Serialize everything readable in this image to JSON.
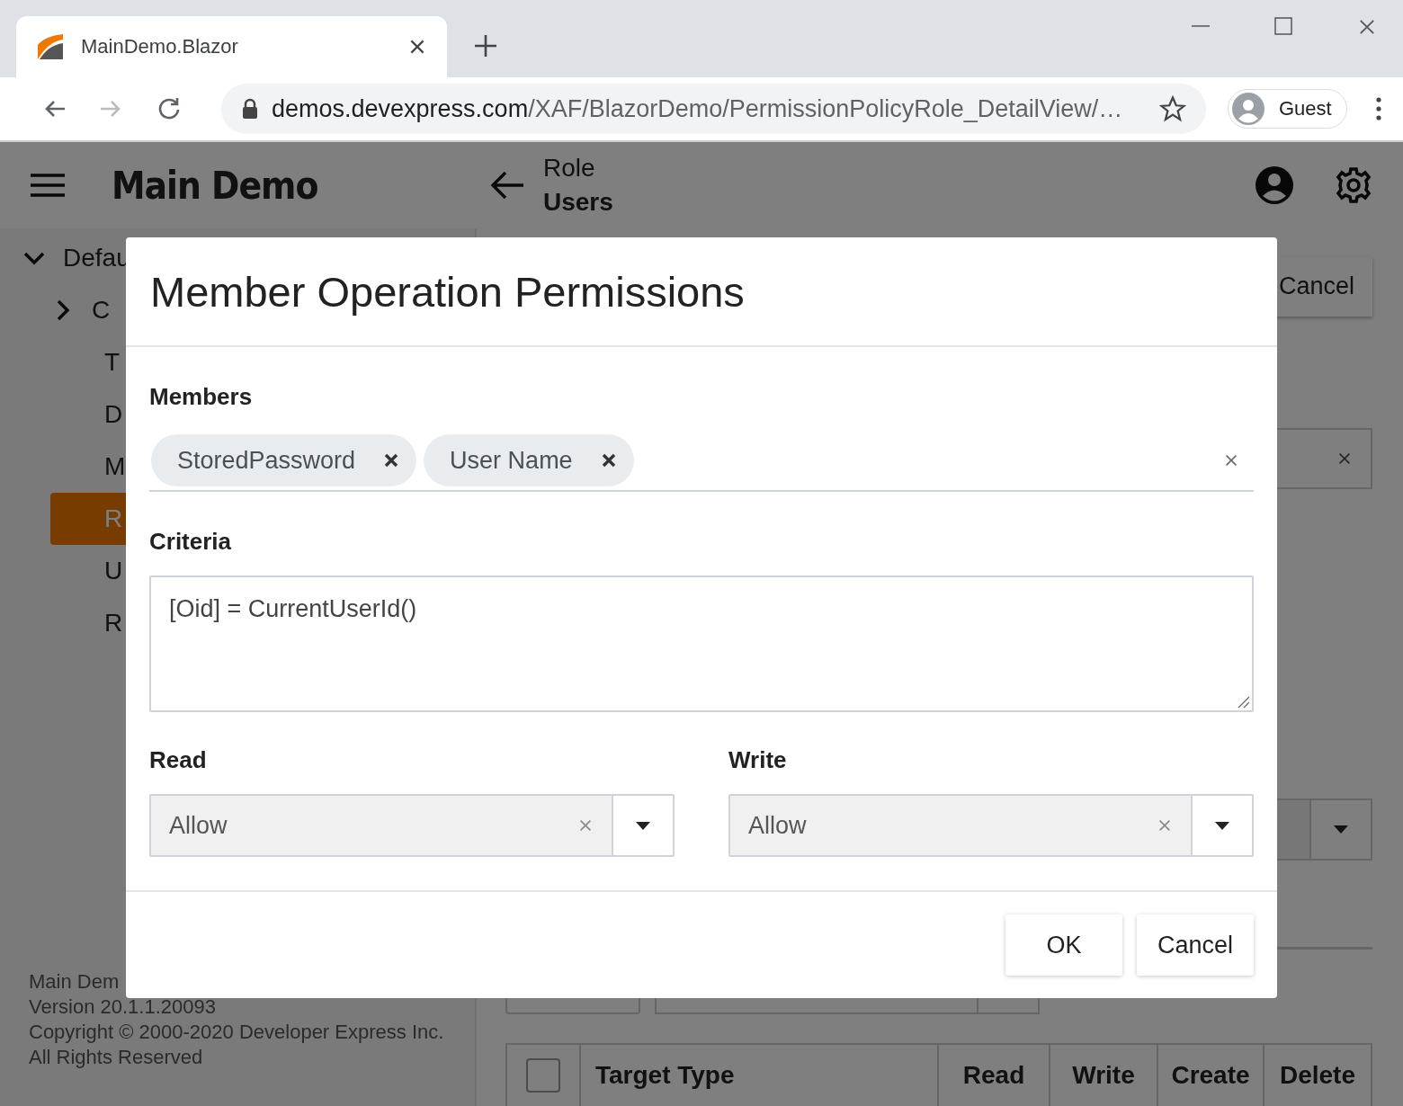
{
  "browser": {
    "tab_title": "MainDemo.Blazor",
    "nav": [
      {
        "kind": "back",
        "disabled": false
      },
      {
        "kind": "forward",
        "disabled": true
      },
      {
        "kind": "reload",
        "disabled": false
      }
    ],
    "url_host": "demos.devexpress.com",
    "url_path": "/XAF/BlazorDemo/PermissionPolicyRole_DetailView/…",
    "profile_name": "Guest"
  },
  "app": {
    "title": "Main Demo",
    "breadcrumb_parent": "Role",
    "breadcrumb_current": "Users"
  },
  "sidebar": {
    "items": [
      {
        "label": "Defau",
        "expanded": true,
        "selected": false,
        "children": [
          {
            "label": "C",
            "expanded": false,
            "selected": false
          },
          {
            "label": "T",
            "selected": false
          },
          {
            "label": "D",
            "selected": false
          },
          {
            "label": "M",
            "selected": false
          },
          {
            "label": "R",
            "selected": true
          },
          {
            "label": "U",
            "selected": false
          },
          {
            "label": "R",
            "selected": false
          }
        ]
      }
    ],
    "footer": [
      "Main Dem",
      "Version 20.1.1.20093",
      "Copyright © 2000-2020 Developer Express Inc.",
      "All Rights Reserved"
    ]
  },
  "background": {
    "cancel_button": "Cancel",
    "select_all_checked": false,
    "table_columns": [
      "Target Type",
      "Read",
      "Write",
      "Create",
      "Delete"
    ]
  },
  "dialog": {
    "title": "Member Operation Permissions",
    "members": {
      "label": "Members",
      "tags": [
        "StoredPassword",
        "User Name"
      ]
    },
    "criteria": {
      "label": "Criteria",
      "value": "[Oid] = CurrentUserId()"
    },
    "read": {
      "label": "Read",
      "value": "Allow"
    },
    "write": {
      "label": "Write",
      "value": "Allow"
    },
    "buttons": [
      "OK",
      "Cancel"
    ]
  }
}
